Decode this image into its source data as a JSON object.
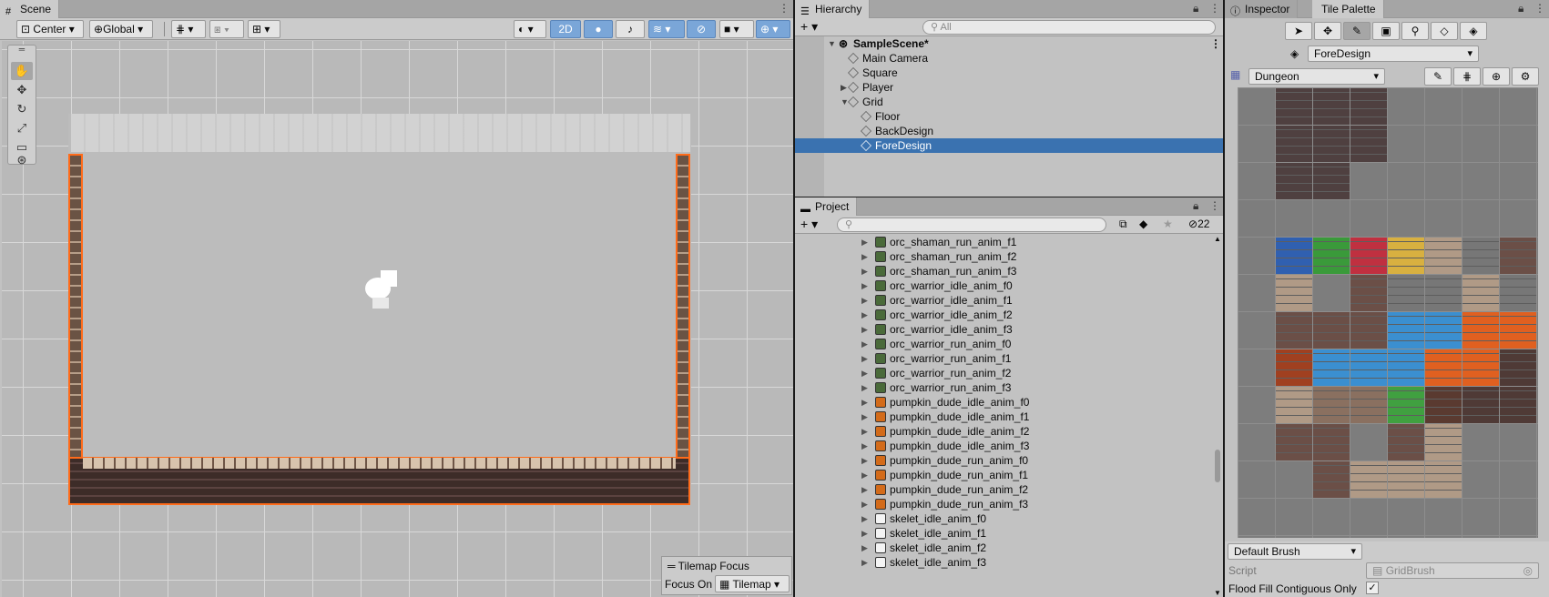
{
  "scene": {
    "tab_label": "Scene",
    "pivot_mode": "Center",
    "pivot_rotation": "Global",
    "mode_2d": "2D",
    "tilemap_focus": {
      "title": "Tilemap Focus",
      "focus_on_label": "Focus On",
      "focus_value": "Tilemap"
    }
  },
  "hierarchy": {
    "tab_label": "Hierarchy",
    "search_placeholder": "All",
    "scene_name": "SampleScene*",
    "items": [
      "Main Camera",
      "Square",
      "Player",
      "Grid",
      "Floor",
      "BackDesign",
      "ForeDesign"
    ],
    "selected": "ForeDesign"
  },
  "project": {
    "tab_label": "Project",
    "hidden_count": "22",
    "items": [
      "orc_shaman_run_anim_f1",
      "orc_shaman_run_anim_f2",
      "orc_shaman_run_anim_f3",
      "orc_warrior_idle_anim_f0",
      "orc_warrior_idle_anim_f1",
      "orc_warrior_idle_anim_f2",
      "orc_warrior_idle_anim_f3",
      "orc_warrior_run_anim_f0",
      "orc_warrior_run_anim_f1",
      "orc_warrior_run_anim_f2",
      "orc_warrior_run_anim_f3",
      "pumpkin_dude_idle_anim_f0",
      "pumpkin_dude_idle_anim_f1",
      "pumpkin_dude_idle_anim_f2",
      "pumpkin_dude_idle_anim_f3",
      "pumpkin_dude_run_anim_f0",
      "pumpkin_dude_run_anim_f1",
      "pumpkin_dude_run_anim_f2",
      "pumpkin_dude_run_anim_f3",
      "skelet_idle_anim_f0",
      "skelet_idle_anim_f1",
      "skelet_idle_anim_f2",
      "skelet_idle_anim_f3"
    ]
  },
  "inspector": {
    "tab_label": "Inspector",
    "tile_palette_tab": "Tile Palette",
    "active_tilemap": "ForeDesign",
    "palette_name": "Dungeon",
    "brush": "Default Brush",
    "script_label": "Script",
    "script_value": "GridBrush",
    "flood_fill_label": "Flood Fill Contiguous Only",
    "flood_fill_checked": "✓"
  },
  "colors": {
    "selection": "#3a72b0",
    "outline": "#ff6b1a",
    "toggle_on": "#7aa6d8"
  }
}
